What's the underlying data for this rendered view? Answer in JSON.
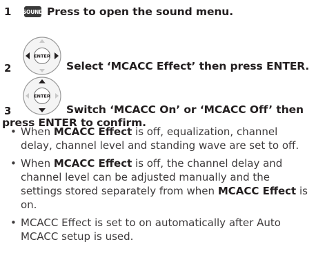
{
  "steps": [
    {
      "number": "1",
      "button_label": "SOUND",
      "text": "Press to open the sound menu."
    },
    {
      "number": "2",
      "button_label": "ENTER",
      "text": "Select ‘MCACC Effect’ then press ENTER."
    },
    {
      "number": "3",
      "button_label": "ENTER",
      "text_line1": "Switch ‘MCACC On’ or ‘MCACC Off’ then",
      "text_line2": "press ENTER to confirm."
    }
  ],
  "bullets": [
    {
      "bold": "MCACC Effect",
      "pre": "When ",
      "post": " is off, equalization, channel delay, channel level and standing wave are set to off."
    },
    {
      "pre": "When ",
      "bold": "MCACC Effect",
      "mid": " is off, the channel delay and channel level can be adjusted manually and the settings stored separately from when ",
      "bold2": "MCACC Effect",
      "post": " is on."
    },
    {
      "text": "MCACC Effect is set to on automatically after Auto MCACC setup is used."
    }
  ],
  "icons": {
    "pad_step2": "left-right-arrows-icon",
    "pad_step3": "up-down-arrows-icon"
  }
}
